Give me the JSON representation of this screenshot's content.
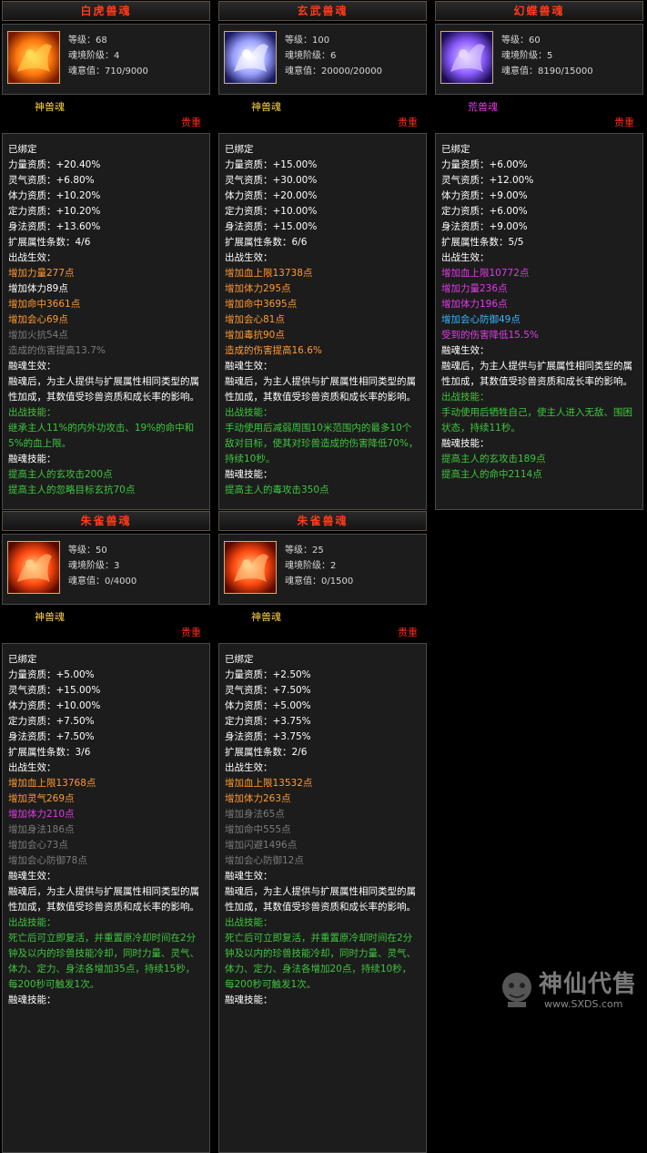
{
  "colors": {
    "green": "#3ec63e",
    "white": "#ffffff",
    "orange": "#ff9a33",
    "purple": "#e03ce6",
    "cyan": "#36b6ff",
    "grey": "#7c7c7c",
    "title": "#ff3a1a",
    "grade": "#ff2a1a"
  },
  "cards": [
    {
      "title": "白虎兽魂",
      "icon": "white-tiger-soul-icon",
      "stats": {
        "level": "等级：68",
        "realm": "魂境阶级：4",
        "will": "魂意值：710/9000"
      },
      "soul_type": "神兽魂",
      "soul_type_color": "#ffd24a",
      "grade": "贵重",
      "bound": "已绑定",
      "attributes": [
        "力量资质：+20.40%",
        "灵气资质：+6.80%",
        "体力资质：+10.20%",
        "定力资质：+10.20%",
        "身法资质：+13.60%"
      ],
      "ext_count": "扩展属性条数：4/6",
      "battle_label": "出战生效：",
      "bonuses": [
        {
          "text": "增加力量277点",
          "color": "orange"
        },
        {
          "text": "增加体力89点",
          "color": "white"
        },
        {
          "text": "增加命中3661点",
          "color": "orange"
        },
        {
          "text": "增加会心69点",
          "color": "orange"
        },
        {
          "text": "增加火抗54点",
          "color": "grey"
        },
        {
          "text": "造成的伤害提高13.7%",
          "color": "grey"
        }
      ],
      "fusion_label": "融魂生效：",
      "fusion_text": "融魂后，为主人提供与扩展属性相同类型的属性加成，其数值受珍兽资质和成长率的影响。",
      "skill_label": "出战技能：",
      "skill_text": "继承主人11%的内外功攻击、19%的命中和5%的血上限。",
      "fusion_skill_label": "融魂技能：",
      "fusion_skills": [
        "提高主人的玄攻击200点",
        "提高主人的忽略目标玄抗70点"
      ]
    },
    {
      "title": "玄武兽魂",
      "icon": "black-tortoise-soul-icon",
      "stats": {
        "level": "等级：100",
        "realm": "魂境阶级：6",
        "will": "魂意值：20000/20000"
      },
      "soul_type": "神兽魂",
      "soul_type_color": "#ffd24a",
      "grade": "贵重",
      "bound": "已绑定",
      "attributes": [
        "力量资质：+15.00%",
        "灵气资质：+30.00%",
        "体力资质：+20.00%",
        "定力资质：+10.00%",
        "身法资质：+15.00%"
      ],
      "ext_count": "扩展属性条数：6/6",
      "battle_label": "出战生效：",
      "bonuses": [
        {
          "text": "增加血上限13738点",
          "color": "orange"
        },
        {
          "text": "增加体力295点",
          "color": "orange"
        },
        {
          "text": "增加命中3695点",
          "color": "orange"
        },
        {
          "text": "增加会心81点",
          "color": "orange"
        },
        {
          "text": "增加毒抗90点",
          "color": "orange"
        },
        {
          "text": "造成的伤害提高16.6%",
          "color": "orange"
        }
      ],
      "fusion_label": "融魂生效：",
      "fusion_text": "融魂后，为主人提供与扩展属性相同类型的属性加成，其数值受珍兽资质和成长率的影响。",
      "skill_label": "出战技能：",
      "skill_text": "手动使用后减弱周围10米范围内的最多10个敌对目标，使其对珍兽造成的伤害降低70%，持续10秒。",
      "fusion_skill_label": "融魂技能：",
      "fusion_skills": [
        "提高主人的毒攻击350点"
      ]
    },
    {
      "title": "幻蝶兽魂",
      "icon": "phantom-butterfly-soul-icon",
      "stats": {
        "level": "等级：60",
        "realm": "魂境阶级：5",
        "will": "魂意值：8190/15000"
      },
      "soul_type": "荒兽魂",
      "soul_type_color": "#e03ce6",
      "grade": "贵重",
      "bound": "已绑定",
      "attributes": [
        "力量资质：+6.00%",
        "灵气资质：+12.00%",
        "体力资质：+9.00%",
        "定力资质：+6.00%",
        "身法资质：+9.00%"
      ],
      "ext_count": "扩展属性条数：5/5",
      "battle_label": "出战生效：",
      "bonuses": [
        {
          "text": "增加血上限10772点",
          "color": "purple"
        },
        {
          "text": "增加力量236点",
          "color": "purple"
        },
        {
          "text": "增加体力196点",
          "color": "purple"
        },
        {
          "text": "增加会心防御49点",
          "color": "cyan"
        },
        {
          "text": "受到的伤害降低15.5%",
          "color": "purple"
        }
      ],
      "fusion_label": "融魂生效：",
      "fusion_text": "融魂后，为主人提供与扩展属性相同类型的属性加成，其数值受珍兽资质和成长率的影响。",
      "skill_label": "出战技能：",
      "skill_text": "手动使用后牺牲自己，使主人进入无敌、围困状态，持续11秒。",
      "fusion_skill_label": "融魂技能：",
      "fusion_skills": [
        "提高主人的玄攻击189点",
        "提高主人的命中2114点"
      ]
    },
    {
      "title": "朱雀兽魂",
      "icon": "vermilion-bird-soul-icon",
      "stats": {
        "level": "等级：50",
        "realm": "魂境阶级：3",
        "will": "魂意值：0/4000"
      },
      "soul_type": "神兽魂",
      "soul_type_color": "#ffd24a",
      "grade": "贵重",
      "bound": "已绑定",
      "attributes": [
        "力量资质：+5.00%",
        "灵气资质：+15.00%",
        "体力资质：+10.00%",
        "定力资质：+7.50%",
        "身法资质：+7.50%"
      ],
      "ext_count": "扩展属性条数：3/6",
      "battle_label": "出战生效：",
      "bonuses": [
        {
          "text": "增加血上限13768点",
          "color": "orange"
        },
        {
          "text": "增加灵气269点",
          "color": "orange"
        },
        {
          "text": "增加体力210点",
          "color": "purple"
        },
        {
          "text": "增加身法186点",
          "color": "grey"
        },
        {
          "text": "增加会心73点",
          "color": "grey"
        },
        {
          "text": "增加会心防御78点",
          "color": "grey"
        }
      ],
      "fusion_label": "融魂生效：",
      "fusion_text": "融魂后，为主人提供与扩展属性相同类型的属性加成，其数值受珍兽资质和成长率的影响。",
      "skill_label": "出战技能：",
      "skill_text": "死亡后可立即复活，并重置原冷却时间在2分钟及以内的珍兽技能冷却，同时力量、灵气、体力、定力、身法各增加35点，持续15秒，每200秒可触发1次。",
      "fusion_skill_label": "融魂技能：",
      "fusion_skills": []
    },
    {
      "title": "朱雀兽魂",
      "icon": "vermilion-bird-soul-icon",
      "stats": {
        "level": "等级：25",
        "realm": "魂境阶级：2",
        "will": "魂意值：0/1500"
      },
      "soul_type": "神兽魂",
      "soul_type_color": "#ffd24a",
      "grade": "贵重",
      "bound": "已绑定",
      "attributes": [
        "力量资质：+2.50%",
        "灵气资质：+7.50%",
        "体力资质：+5.00%",
        "定力资质：+3.75%",
        "身法资质：+3.75%"
      ],
      "ext_count": "扩展属性条数：2/6",
      "battle_label": "出战生效：",
      "bonuses": [
        {
          "text": "增加血上限13532点",
          "color": "orange"
        },
        {
          "text": "增加体力263点",
          "color": "orange"
        },
        {
          "text": "增加身法65点",
          "color": "grey"
        },
        {
          "text": "增加命中555点",
          "color": "grey"
        },
        {
          "text": "增加闪避1496点",
          "color": "grey"
        },
        {
          "text": "增加会心防御12点",
          "color": "grey"
        }
      ],
      "fusion_label": "融魂生效：",
      "fusion_text": "融魂后，为主人提供与扩展属性相同类型的属性加成，其数值受珍兽资质和成长率的影响。",
      "skill_label": "出战技能：",
      "skill_text": "死亡后可立即复活，并重置原冷却时间在2分钟及以内的珍兽技能冷却，同时力量、灵气、体力、定力、身法各增加20点，持续10秒，每200秒可触发1次。",
      "fusion_skill_label": "融魂技能：",
      "fusion_skills": []
    }
  ],
  "watermark": {
    "text": "神仙代售",
    "url": "www.SXDS.com"
  }
}
